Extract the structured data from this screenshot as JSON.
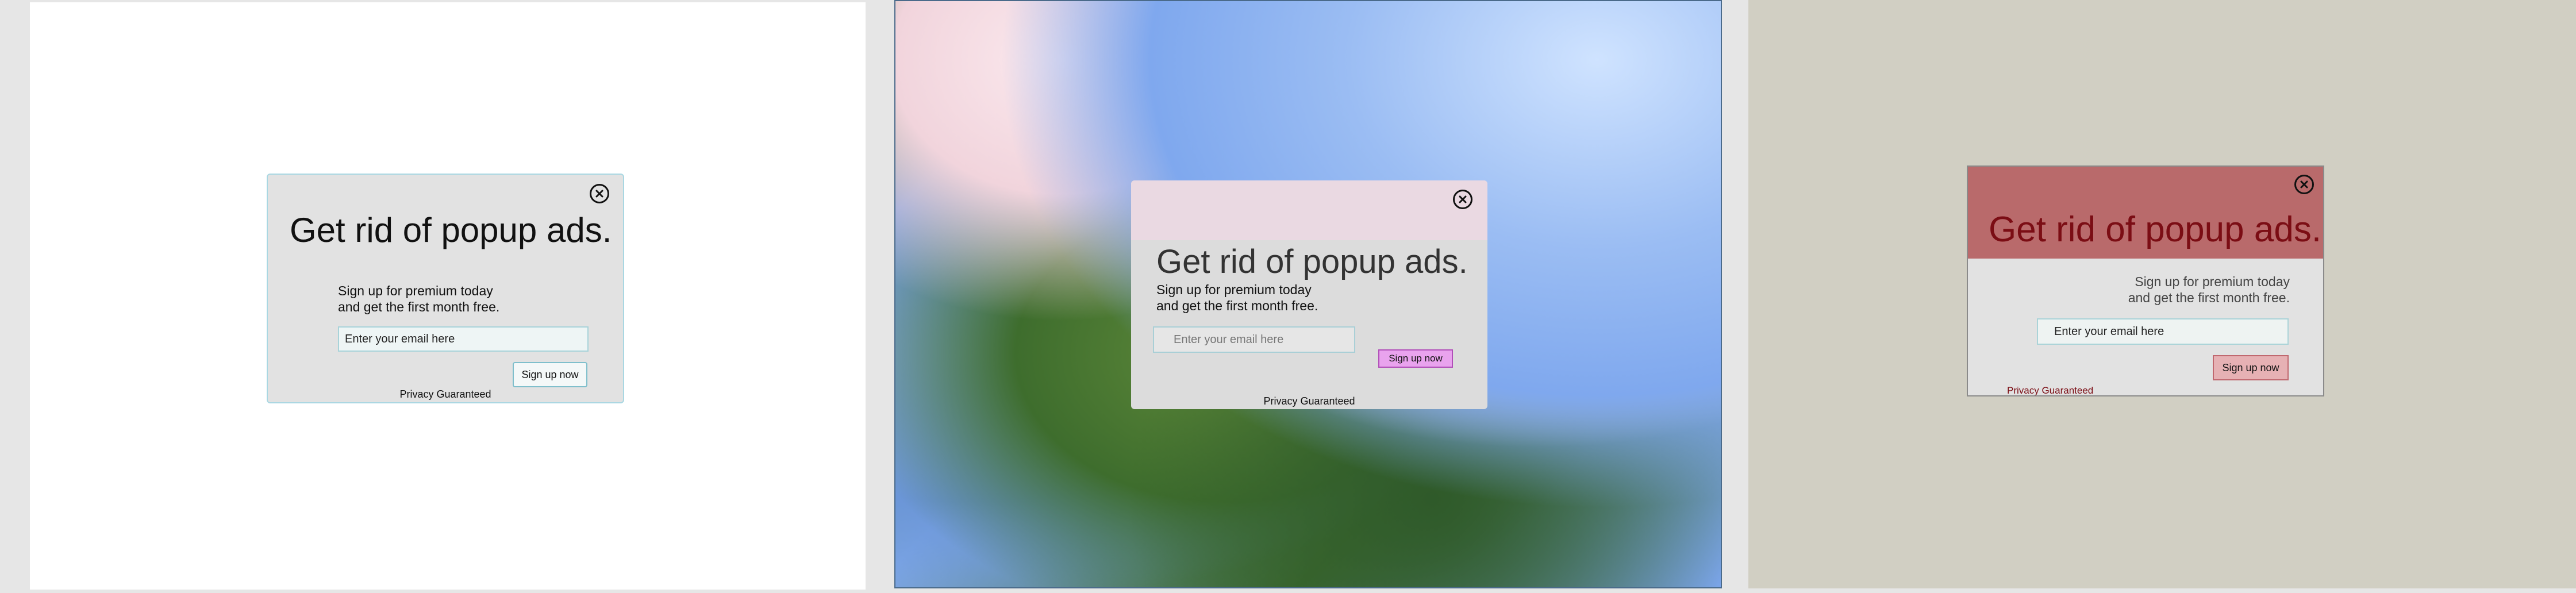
{
  "popups": [
    {
      "title": "Get rid of popup ads.",
      "subtitle_line1": "Sign up for premium today",
      "subtitle_line2": "and get the first month free.",
      "email_placeholder": "Enter your email here",
      "button_label": "Sign up now",
      "privacy_text": "Privacy Guaranteed"
    },
    {
      "title": "Get rid of popup ads.",
      "subtitle_line1": "Sign up for premium today",
      "subtitle_line2": "and get the first month free.",
      "email_placeholder": "Enter your email here",
      "button_label": "Sign up now",
      "privacy_text": "Privacy Guaranteed"
    },
    {
      "title": "Get rid of popup ads.",
      "subtitle_line1": "Sign up for premium today",
      "subtitle_line2": "and get the first month free.",
      "email_placeholder": "Enter your email here",
      "button_label": "Sign up now",
      "privacy_text": "Privacy Guaranteed"
    }
  ],
  "icons": {
    "close": "close-circle-icon"
  },
  "colors": {
    "popup1_border": "#a9d7e2",
    "popup2_band": "#ead9e2",
    "popup2_button": "#e9a3ee",
    "popup3_band": "#b96a6b",
    "popup3_accent": "#7b0d14",
    "popup3_button": "#e6b1b4"
  }
}
